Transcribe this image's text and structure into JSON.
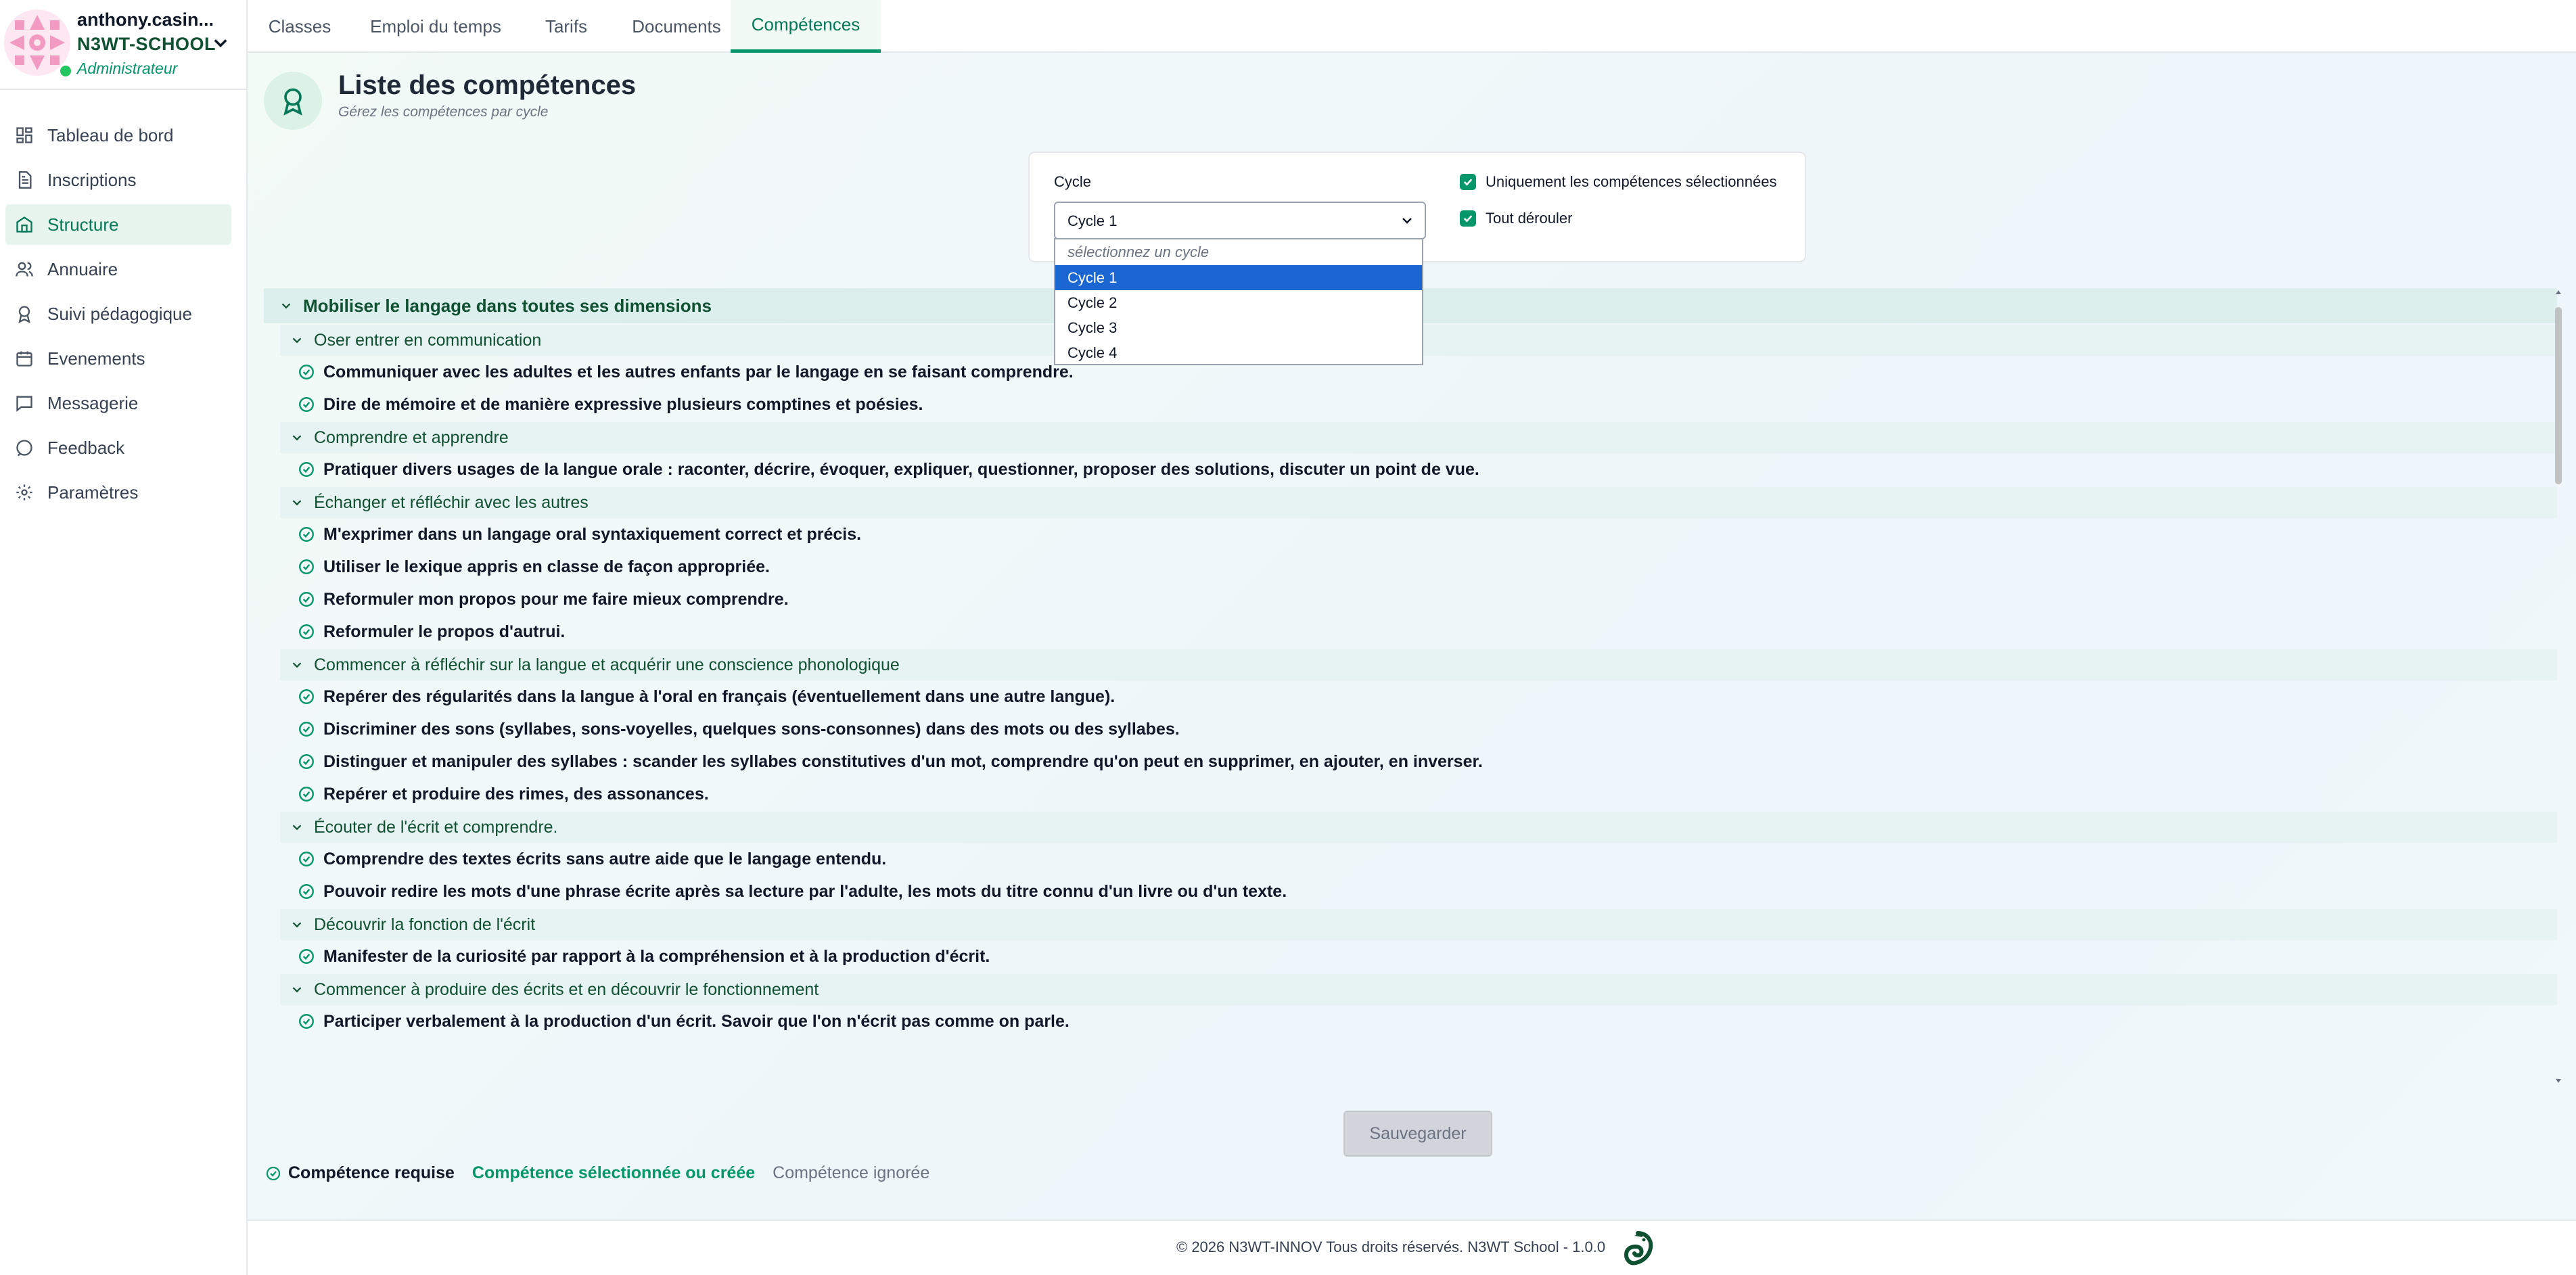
{
  "user": {
    "name": "anthony.casin...",
    "school": "N3WT-SCHOOL",
    "role": "Administrateur"
  },
  "sidebar": {
    "items": [
      {
        "label": "Tableau de bord",
        "icon": "dashboard-icon"
      },
      {
        "label": "Inscriptions",
        "icon": "document-icon"
      },
      {
        "label": "Structure",
        "icon": "building-icon"
      },
      {
        "label": "Annuaire",
        "icon": "users-icon"
      },
      {
        "label": "Suivi pédagogique",
        "icon": "award-icon"
      },
      {
        "label": "Evenements",
        "icon": "calendar-icon"
      },
      {
        "label": "Messagerie",
        "icon": "message-icon"
      },
      {
        "label": "Feedback",
        "icon": "feedback-icon"
      },
      {
        "label": "Paramètres",
        "icon": "gear-icon"
      }
    ]
  },
  "tabs": [
    "Classes",
    "Emploi du temps",
    "Tarifs",
    "Documents",
    "Compétences"
  ],
  "page": {
    "title": "Liste des compétences",
    "subtitle": "Gérez les compétences par cycle"
  },
  "filters": {
    "cycle_label": "Cycle",
    "cycle_value": "Cycle 1",
    "dropdown_placeholder": "sélectionnez un cycle",
    "options": [
      "Cycle 1",
      "Cycle 2",
      "Cycle 3",
      "Cycle 4"
    ],
    "only_selected_label": "Uniquement les compétences sélectionnées",
    "expand_all_label": "Tout dérouler"
  },
  "domain": {
    "title": "Mobiliser le langage dans toutes ses dimensions",
    "groups": [
      {
        "title": "Oser entrer en communication",
        "items": [
          "Communiquer avec les adultes et les autres enfants par le langage en se faisant comprendre.",
          "Dire de mémoire et de manière expressive plusieurs comptines et poésies."
        ]
      },
      {
        "title": "Comprendre et apprendre",
        "items": [
          "Pratiquer divers usages de la langue orale : raconter, décrire, évoquer, expliquer, questionner, proposer des solutions, discuter un point de vue."
        ]
      },
      {
        "title": "Échanger et réfléchir avec les autres",
        "items": [
          "M'exprimer dans un langage oral syntaxiquement correct et précis.",
          "Utiliser le lexique appris en classe de façon appropriée.",
          "Reformuler mon propos pour me faire mieux comprendre.",
          "Reformuler le propos d'autrui."
        ]
      },
      {
        "title": "Commencer à réfléchir sur la langue et acquérir une conscience phonologique",
        "items": [
          "Repérer des régularités dans la langue à l'oral en français (éventuellement dans une autre langue).",
          "Discriminer des sons (syllabes, sons-voyelles, quelques sons-consonnes) dans des mots ou des syllabes.",
          "Distinguer et manipuler des syllabes : scander les syllabes constitutives d'un mot, comprendre qu'on peut en supprimer, en ajouter, en inverser.",
          "Repérer et produire des rimes, des assonances."
        ]
      },
      {
        "title": "Écouter de l'écrit et comprendre.",
        "items": [
          "Comprendre des textes écrits sans autre aide que le langage entendu.",
          "Pouvoir redire les mots d'une phrase écrite après sa lecture par l'adulte, les mots du titre connu d'un livre ou d'un texte."
        ]
      },
      {
        "title": "Découvrir la fonction de l'écrit",
        "items": [
          "Manifester de la curiosité par rapport à la compréhension et à la production d'écrit."
        ]
      },
      {
        "title": "Commencer à produire des écrits et en découvrir le fonctionnement",
        "items": [
          "Participer verbalement à la production d'un écrit. Savoir que l'on n'écrit pas comme on parle."
        ]
      }
    ]
  },
  "actions": {
    "save_label": "Sauvegarder"
  },
  "legend": {
    "required": "Compétence requise",
    "selected": "Compétence sélectionnée ou créée",
    "ignored": "Compétence ignorée"
  },
  "footer": {
    "text": "© 2026 N3WT-INNOV Tous droits réservés. N3WT School - 1.0.0"
  },
  "colors": {
    "accent": "#059669",
    "accent_dark": "#047857",
    "dropdown_selected": "#1a66d2"
  }
}
